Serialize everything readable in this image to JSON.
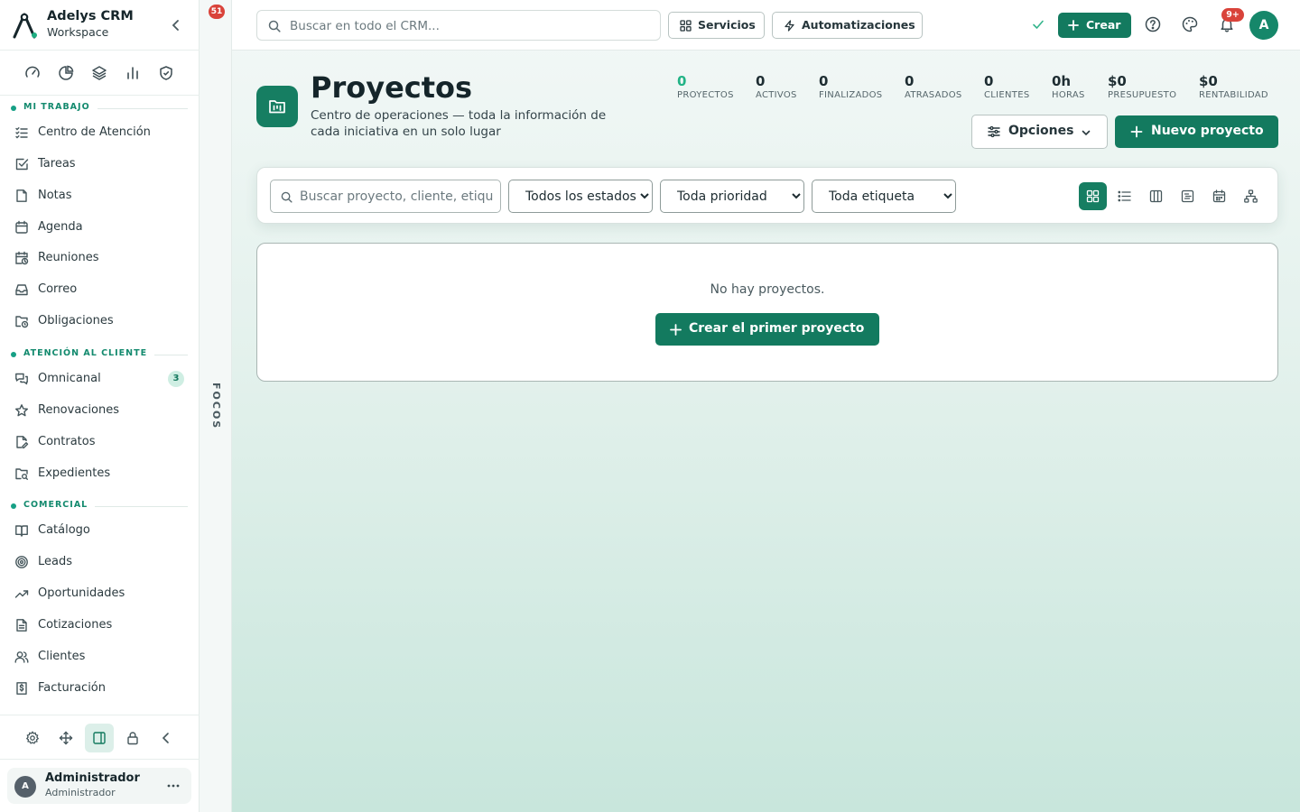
{
  "brand": {
    "name": "Adelys CRM",
    "subtitle": "Workspace"
  },
  "sidebar": {
    "sections": [
      {
        "label": "MI TRABAJO"
      },
      {
        "label": "ATENCIÓN AL CLIENTE"
      },
      {
        "label": "COMERCIAL"
      }
    ],
    "items": [
      {
        "label": "Centro de Atención",
        "icon": "list-check-icon"
      },
      {
        "label": "Tareas",
        "icon": "square-check-icon"
      },
      {
        "label": "Notas",
        "icon": "note-icon"
      },
      {
        "label": "Agenda",
        "icon": "calendar-icon"
      },
      {
        "label": "Reuniones",
        "icon": "calendar-clock-icon"
      },
      {
        "label": "Correo",
        "icon": "inbox-icon"
      },
      {
        "label": "Obligaciones",
        "icon": "folder-clock-icon"
      },
      {
        "label": "Omnicanal",
        "icon": "messages-icon",
        "badge": "3"
      },
      {
        "label": "Renovaciones",
        "icon": "star-icon"
      },
      {
        "label": "Contratos",
        "icon": "file-pen-icon"
      },
      {
        "label": "Expedientes",
        "icon": "folder-search-icon"
      },
      {
        "label": "Catálogo",
        "icon": "book-open-icon"
      },
      {
        "label": "Leads",
        "icon": "target-icon"
      },
      {
        "label": "Oportunidades",
        "icon": "trending-up-icon"
      },
      {
        "label": "Cotizaciones",
        "icon": "file-text-icon"
      },
      {
        "label": "Clientes",
        "icon": "users-icon"
      },
      {
        "label": "Facturación",
        "icon": "receipt-icon"
      }
    ],
    "user": {
      "initial": "A",
      "name": "Administrador",
      "role": "Administrador"
    }
  },
  "focos": {
    "label": "FOCOS",
    "badge": "51"
  },
  "topbar": {
    "search_placeholder": "Buscar en todo el CRM...",
    "servicios_label": "Servicios",
    "automatizaciones_label": "Automatizaciones",
    "crear_label": "Crear",
    "notifications_badge": "9+",
    "avatar_initial": "A"
  },
  "page": {
    "title": "Proyectos",
    "description": "Centro de operaciones — toda la información de cada iniciativa en un solo lugar",
    "stats": [
      {
        "value": "0",
        "label": "PROYECTOS"
      },
      {
        "value": "0",
        "label": "ACTIVOS"
      },
      {
        "value": "0",
        "label": "FINALIZADOS"
      },
      {
        "value": "0",
        "label": "ATRASADOS"
      },
      {
        "value": "0",
        "label": "CLIENTES"
      },
      {
        "value": "0h",
        "label": "HORAS"
      },
      {
        "value": "$0",
        "label": "PRESUPUESTO"
      },
      {
        "value": "$0",
        "label": "RENTABILIDAD"
      }
    ],
    "opciones_label": "Opciones",
    "nuevo_label": "Nuevo proyecto"
  },
  "filters": {
    "search_placeholder": "Buscar proyecto, cliente, etiqueta...",
    "estado_selected": "Todos los estados",
    "prioridad_selected": "Toda prioridad",
    "etiqueta_selected": "Toda etiqueta"
  },
  "empty": {
    "message": "No hay proyectos.",
    "button_label": "Crear el primer proyecto"
  },
  "colors": {
    "accent": "#137a5f",
    "accent_light": "#22b386",
    "danger": "#d9433a"
  }
}
